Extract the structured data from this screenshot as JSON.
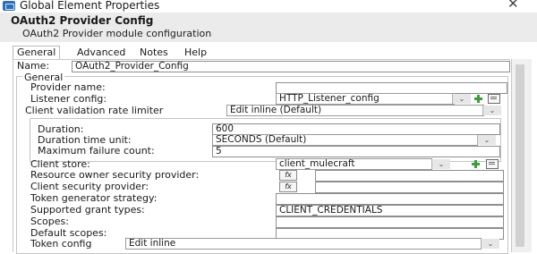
{
  "window": {
    "title": "Global Element Properties",
    "close_glyph": "✕"
  },
  "header": {
    "title": "OAuth2 Provider Config",
    "subtitle": "OAuth2 Provider module configuration"
  },
  "tabs": [
    {
      "label": "General",
      "active": true
    },
    {
      "label": "Advanced",
      "active": false
    },
    {
      "label": "Notes",
      "active": false
    },
    {
      "label": "Help",
      "active": false
    }
  ],
  "name": {
    "label": "Name:",
    "value": "OAuth2_Provider_Config"
  },
  "general": {
    "label": "General",
    "provider_name": {
      "label": "Provider name:",
      "value": ""
    },
    "listener_config": {
      "label": "Listener config:",
      "value": "HTTP_Listener_config"
    },
    "rate_limiter": {
      "label": "Client validation rate limiter",
      "value": "Edit inline (Default)"
    },
    "duration": {
      "label": "Duration:",
      "value": "600"
    },
    "duration_unit": {
      "label": "Duration time unit:",
      "value": "SECONDS (Default)"
    },
    "max_failure": {
      "label": "Maximum failure count:",
      "value": "5"
    },
    "client_store": {
      "label": "Client store:",
      "value": "client_mulecraft"
    },
    "resource_owner_provider": {
      "label": "Resource owner security provider:",
      "value": ""
    },
    "client_security_provider": {
      "label": "Client security provider:",
      "value": ""
    },
    "token_generator": {
      "label": "Token generator strategy:",
      "value": ""
    },
    "grant_types": {
      "label": "Supported grant types:",
      "value": "CLIENT_CREDENTIALS"
    },
    "scopes": {
      "label": "Scopes:",
      "value": ""
    },
    "default_scopes": {
      "label": "Default scopes:",
      "value": ""
    },
    "token_config": {
      "label": "Token config",
      "value": "Edit inline"
    }
  },
  "icons": {
    "expression": "fx",
    "dropdown": "⌄"
  },
  "colors": {
    "add_icon": "#3d9e3d",
    "header_bg": "#ebebeb"
  }
}
